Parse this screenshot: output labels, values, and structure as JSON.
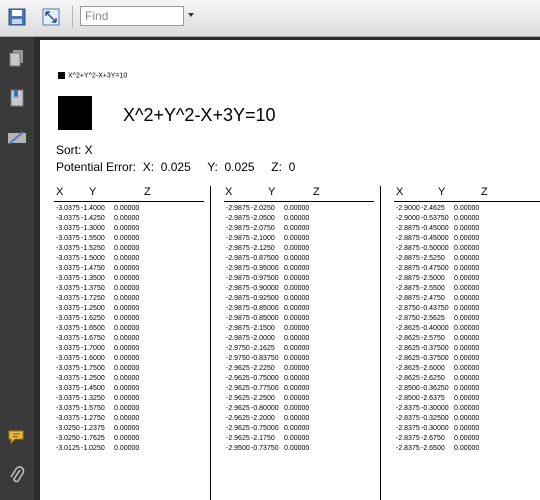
{
  "toolbar": {
    "find_placeholder": "Find",
    "icons": [
      "save-icon",
      "fit-page-icon",
      "dropdown-arrow-icon"
    ]
  },
  "sidebar": {
    "icons": [
      "pages-icon",
      "bookmarks-icon",
      "signatures-icon",
      "comments-icon",
      "attachments-icon"
    ]
  },
  "document": {
    "small_title": "X^2+Y^2-X+3Y=10",
    "big_title": "X^2+Y^2-X+3Y=10",
    "sort": "Sort:  X",
    "potential_error": "Potential Error:  X:  0.025     Y:  0.025     Z:  0",
    "headers": [
      "X",
      "Y",
      "Z"
    ],
    "columns": [
      [
        [
          "-3.0375",
          "-1.4000",
          "0.00000"
        ],
        [
          "-3.0375",
          "-1.4250",
          "0.00000"
        ],
        [
          "-3.0375",
          "-1.3000",
          "0.00000"
        ],
        [
          "-3.0375",
          "-1.5500",
          "0.00000"
        ],
        [
          "-3.0375",
          "-1.5250",
          "0.00000"
        ],
        [
          "-3.0375",
          "-1.5000",
          "0.00000"
        ],
        [
          "-3.0375",
          "-1.4750",
          "0.00000"
        ],
        [
          "-3.0375",
          "-1.3500",
          "0.00000"
        ],
        [
          "-3.0375",
          "-1.3750",
          "0.00000"
        ],
        [
          "-3.0375",
          "-1.7250",
          "0.00000"
        ],
        [
          "-3.0375",
          "-1.2500",
          "0.00000"
        ],
        [
          "-3.0375",
          "-1.6250",
          "0.00000"
        ],
        [
          "-3.0375",
          "-1.6500",
          "0.00000"
        ],
        [
          "-3.0375",
          "-1.6750",
          "0.00000"
        ],
        [
          "-3.0375",
          "-1.7000",
          "0.00000"
        ],
        [
          "-3.0375",
          "-1.6000",
          "0.00000"
        ],
        [
          "-3.0375",
          "-1.7500",
          "0.00000"
        ],
        [
          "-3.0375",
          "-1.2500",
          "0.00000"
        ],
        [
          "-3.0375",
          "-1.4500",
          "0.00000"
        ],
        [
          "-3.0375",
          "-1.3250",
          "0.00000"
        ],
        [
          "-3.0375",
          "-1.5750",
          "0.00000"
        ],
        [
          "-3.0375",
          "-1.2750",
          "0.00000"
        ],
        [
          "-3.0250",
          "-1.2375",
          "0.00000"
        ],
        [
          "-3.0250",
          "-1.7625",
          "0.00000"
        ],
        [
          "-3.0125",
          "-1.0250",
          "0.00000"
        ]
      ],
      [
        [
          "-2.9875",
          "-2.0250",
          "0.00000"
        ],
        [
          "-2.9875",
          "-2.0500",
          "0.00000"
        ],
        [
          "-2.9875",
          "-2.0750",
          "0.00000"
        ],
        [
          "-2.9875",
          "-2.1000",
          "0.00000"
        ],
        [
          "-2.9875",
          "-2.1250",
          "0.00000"
        ],
        [
          "-2.9875",
          "-0.87500",
          "0.00000"
        ],
        [
          "-2.9875",
          "-0.95000",
          "0.00000"
        ],
        [
          "-2.9875",
          "-0.97500",
          "0.00000"
        ],
        [
          "-2.9875",
          "-0.90000",
          "0.00000"
        ],
        [
          "-2.9875",
          "-0.92500",
          "0.00000"
        ],
        [
          "-2.9875",
          "-0.85000",
          "0.00000"
        ],
        [
          "-2.9875",
          "-0.85000",
          "0.00000"
        ],
        [
          "-2.9875",
          "-2.1500",
          "0.00000"
        ],
        [
          "-2.9875",
          "-2.0000",
          "0.00000"
        ],
        [
          "-2.9750",
          "-2.1625",
          "0.00000"
        ],
        [
          "-2.9750",
          "-0.83750",
          "0.00000"
        ],
        [
          "-2.9625",
          "-2.2250",
          "0.00000"
        ],
        [
          "-2.9625",
          "-0.75000",
          "0.00000"
        ],
        [
          "-2.9625",
          "-0.77500",
          "0.00000"
        ],
        [
          "-2.9625",
          "-2.2500",
          "0.00000"
        ],
        [
          "-2.9625",
          "-0.80000",
          "0.00000"
        ],
        [
          "-2.9625",
          "-2.2000",
          "0.00000"
        ],
        [
          "-2.9625",
          "-0.75000",
          "0.00000"
        ],
        [
          "-2.9625",
          "-2.1750",
          "0.00000"
        ],
        [
          "-2.9500",
          "-0.73750",
          "0.00000"
        ]
      ],
      [
        [
          "-2.9000",
          "-2.4625",
          "0.00000"
        ],
        [
          "-2.9000",
          "-0.53750",
          "0.00000"
        ],
        [
          "-2.8875",
          "-0.45000",
          "0.00000"
        ],
        [
          "-2.8875",
          "-0.45000",
          "0.00000"
        ],
        [
          "-2.8875",
          "-0.50000",
          "0.00000"
        ],
        [
          "-2.8875",
          "-2.5250",
          "0.00000"
        ],
        [
          "-2.8875",
          "-0.47500",
          "0.00000"
        ],
        [
          "-2.8875",
          "-2.5000",
          "0.00000"
        ],
        [
          "-2.8875",
          "-2.5500",
          "0.00000"
        ],
        [
          "-2.8875",
          "-2.4750",
          "0.00000"
        ],
        [
          "-2.8750",
          "-0.43750",
          "0.00000"
        ],
        [
          "-2.8750",
          "-2.5625",
          "0.00000"
        ],
        [
          "-2.8625",
          "-0.40000",
          "0.00000"
        ],
        [
          "-2.8625",
          "-2.5750",
          "0.00000"
        ],
        [
          "-2.8625",
          "-0.37500",
          "0.00000"
        ],
        [
          "-2.8625",
          "-0.37500",
          "0.00000"
        ],
        [
          "-2.8625",
          "-2.6000",
          "0.00000"
        ],
        [
          "-2.8625",
          "-2.6250",
          "0.00000"
        ],
        [
          "-2.8500",
          "-0.36250",
          "0.00000"
        ],
        [
          "-2.8500",
          "-2.6375",
          "0.00000"
        ],
        [
          "-2.8375",
          "-0.30000",
          "0.00000"
        ],
        [
          "-2.8375",
          "-0.32500",
          "0.00000"
        ],
        [
          "-2.8375",
          "-0.30000",
          "0.00000"
        ],
        [
          "-2.8375",
          "-2.6750",
          "0.00000"
        ],
        [
          "-2.8375",
          "-2.6500",
          "0.00000"
        ]
      ]
    ]
  }
}
